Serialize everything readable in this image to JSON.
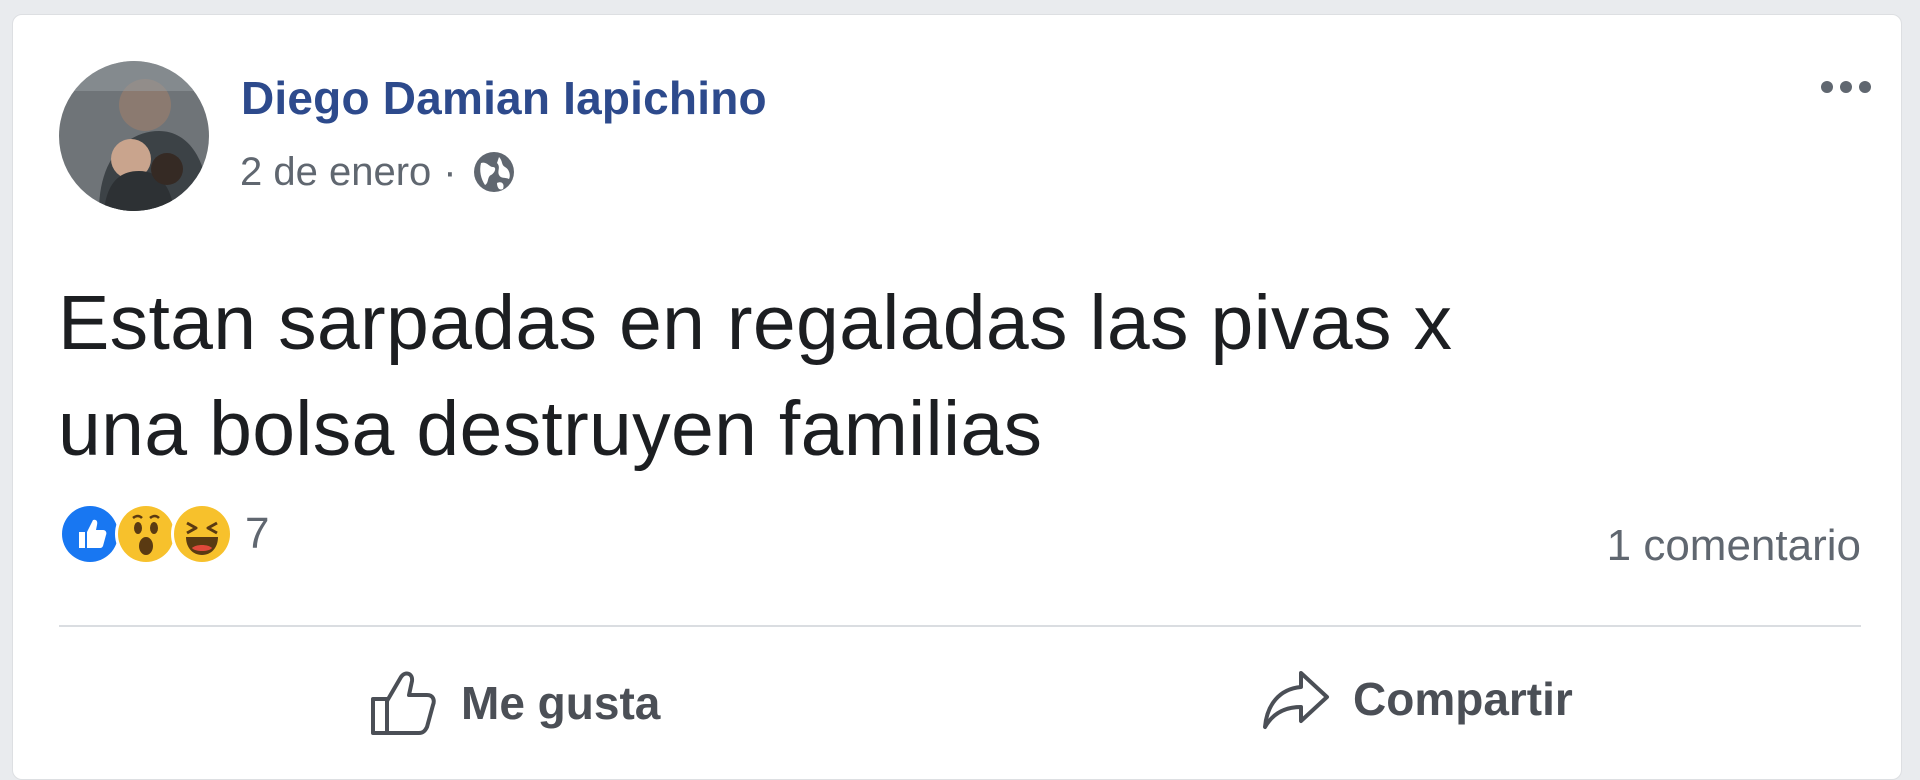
{
  "post": {
    "author": "Diego Damian Iapichino",
    "date": "2 de enero",
    "separator": "·",
    "privacy_icon": "globe-icon",
    "text_line1": "Estan sarpadas en regaladas las pivas x",
    "text_line2": "una bolsa destruyen familias",
    "reactions": {
      "icons": [
        "like-icon",
        "wow-icon",
        "haha-icon"
      ],
      "count": "7"
    },
    "comments": "1 comentario"
  },
  "actions": {
    "like_label": "Me gusta",
    "share_label": "Compartir"
  },
  "colors": {
    "author": "#2d4a8c",
    "secondary_text": "#606770",
    "like_blue": "#1877f2",
    "reaction_yellow": "#f7c12c"
  }
}
